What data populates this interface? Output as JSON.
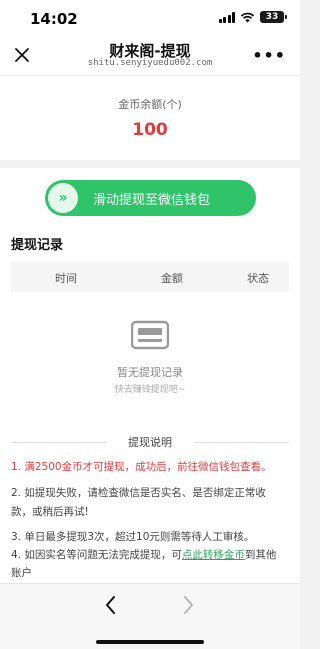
{
  "status": {
    "time": "14:02",
    "battery": "33"
  },
  "nav": {
    "title": "财来阁-提现",
    "url": "shitu.senyiyuedu002.com",
    "more": "•••"
  },
  "balance": {
    "label": "金币余额(个)",
    "value": "100"
  },
  "slider": {
    "knob": "»",
    "text": "滑动提现至微信钱包"
  },
  "records": {
    "title": "提现记录",
    "columns": [
      "时间",
      "金额",
      "状态"
    ],
    "empty_text": "暂无提现记录",
    "empty_sub": "快去赚钱提现吧~"
  },
  "instructions": {
    "title": "提现说明",
    "rule1": "1. 满2500金币才可提现，成功后，前往微信钱包查看。",
    "rule2a": "2. 如提现失败，请检查微信是否实名、是否绑定正常收",
    "rule2b": "款，或稍后再试!",
    "rule3": "3. 单日最多提现3次，超过10元则需等待人工审核。",
    "rule4_prefix": "4. 如因实名等问题无法完成提现，可",
    "rule4_link": "点此转移金币",
    "rule4_suffix": "到其他",
    "rule4_line2": "账户"
  },
  "colors": {
    "accent_green": "#2fc46a",
    "balance_red": "#e5393a"
  }
}
